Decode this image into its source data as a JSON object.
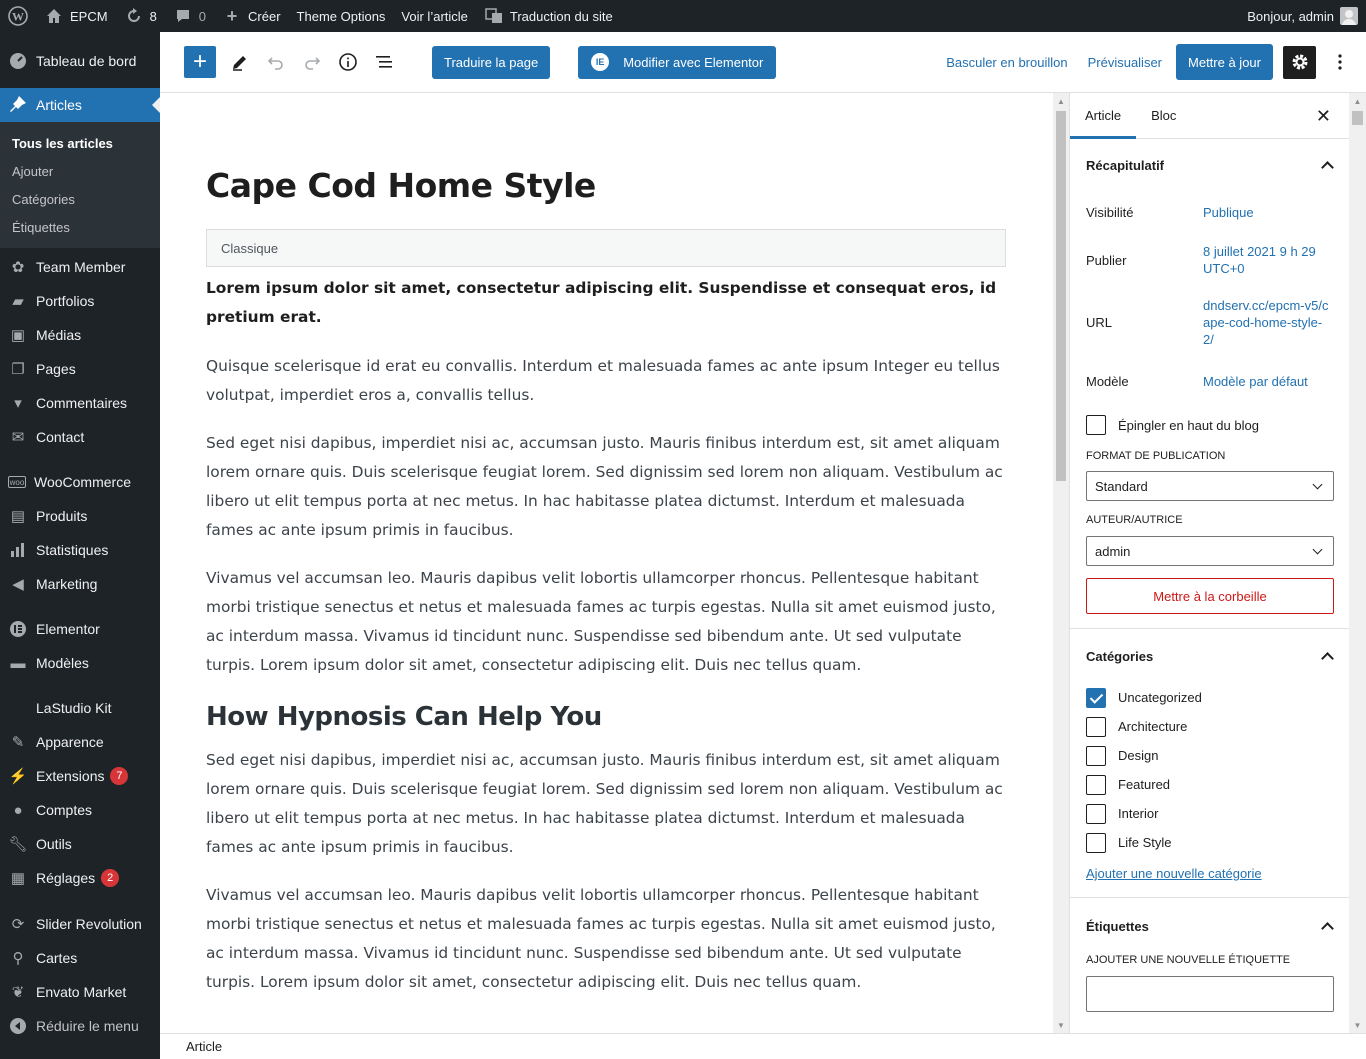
{
  "adminbar": {
    "site_name": "EPCM",
    "updates_count": "8",
    "comments_count": "0",
    "create_label": "Créer",
    "theme_options": "Theme Options",
    "view_post": "Voir l’article",
    "translate_site": "Traduction du site",
    "greeting": "Bonjour, admin"
  },
  "sidebar": {
    "dashboard": "Tableau de bord",
    "articles": "Articles",
    "sub": [
      "Tous les articles",
      "Ajouter",
      "Catégories",
      "Étiquettes"
    ],
    "items_a": [
      "Team Member",
      "Portfolios",
      "Médias",
      "Pages",
      "Commentaires",
      "Contact"
    ],
    "items_b": [
      "WooCommerce",
      "Produits",
      "Statistiques",
      "Marketing"
    ],
    "items_c": [
      "Elementor",
      "Modèles"
    ],
    "items_d": [
      "LaStudio Kit",
      "Apparence",
      "Extensions",
      "Comptes",
      "Outils",
      "Réglages"
    ],
    "extensions_badge": "7",
    "reglages_badge": "2",
    "items_e": [
      "Slider Revolution",
      "Cartes",
      "Envato Market"
    ],
    "collapse": "Réduire le menu"
  },
  "header": {
    "translate_page": "Traduire la page",
    "elementor": "Modifier avec Elementor",
    "draft": "Basculer en brouillon",
    "preview": "Prévisualiser",
    "update": "Mettre à jour"
  },
  "post": {
    "title": "Cape Cod Home Style",
    "classic_label": "Classique",
    "lead": "Lorem ipsum dolor sit amet, consectetur adipiscing elit. Suspendisse et consequat eros, id pretium erat.",
    "p1": "Quisque scelerisque id erat eu convallis. Interdum et malesuada fames ac ante ipsum Integer eu tellus volutpat, imperdiet eros a, convallis tellus.",
    "p2": "Sed eget nisi dapibus, imperdiet nisi ac, accumsan justo. Mauris finibus interdum est, sit amet aliquam lorem ornare quis. Duis scelerisque feugiat lorem. Sed dignissim sed lorem non aliquam. Vestibulum ac libero ut elit tempus porta at nec metus. In hac habitasse platea dictumst. Interdum et malesuada fames ac ante ipsum primis in faucibus.",
    "p3": "Vivamus vel accumsan leo. Mauris dapibus velit lobortis ullamcorper rhoncus. Pellentesque habitant morbi tristique senectus et netus et malesuada fames ac turpis egestas. Nulla sit amet euismod justo, ac interdum massa. Vivamus id tincidunt nunc. Suspendisse sed bibendum ante. Ut sed vulputate turpis. Lorem ipsum dolor sit amet, consectetur adipiscing elit. Duis nec tellus quam.",
    "h2": "How Hypnosis Can Help You",
    "p4": "Sed eget nisi dapibus, imperdiet nisi ac, accumsan justo. Mauris finibus interdum est, sit amet aliquam lorem ornare quis. Duis scelerisque feugiat lorem. Sed dignissim sed lorem non aliquam. Vestibulum ac libero ut elit tempus porta at nec metus. In hac habitasse platea dictumst. Interdum et malesuada fames ac ante ipsum primis in faucibus.",
    "p5": "Vivamus vel accumsan leo. Mauris dapibus velit lobortis ullamcorper rhoncus. Pellentesque habitant morbi tristique senectus et netus et malesuada fames ac turpis egestas. Nulla sit amet euismod justo, ac interdum massa. Vivamus id tincidunt nunc. Suspendisse sed bibendum ante. Ut sed vulputate turpis. Lorem ipsum dolor sit amet, consectetur adipiscing elit. Duis nec tellus quam."
  },
  "settings": {
    "tab_article": "Article",
    "tab_bloc": "Bloc",
    "summary_title": "Récapitulatif",
    "visibility_label": "Visibilité",
    "visibility_value": "Publique",
    "publish_label": "Publier",
    "publish_value": "8 juillet 2021 9 h 29 UTC+0",
    "url_label": "URL",
    "url_value": "dndserv.cc/epcm-v5/cape-cod-home-style-2/",
    "template_label": "Modèle",
    "template_value": "Modèle par défaut",
    "sticky_label": "Épingler en haut du blog",
    "format_label": "FORMAT DE PUBLICATION",
    "format_value": "Standard",
    "author_label": "AUTEUR/AUTRICE",
    "author_value": "admin",
    "trash": "Mettre à la corbeille",
    "categories_title": "Catégories",
    "categories": [
      {
        "name": "Uncategorized",
        "checked": true
      },
      {
        "name": "Architecture",
        "checked": false
      },
      {
        "name": "Design",
        "checked": false
      },
      {
        "name": "Featured",
        "checked": false
      },
      {
        "name": "Interior",
        "checked": false
      },
      {
        "name": "Life Style",
        "checked": false
      }
    ],
    "add_category": "Ajouter une nouvelle catégorie",
    "tags_title": "Étiquettes",
    "add_tag_label": "AJOUTER UNE NOUVELLE ÉTIQUETTE"
  },
  "footer": {
    "breadcrumb": "Article"
  },
  "colors": {
    "accent": "#2271b1",
    "admin_dark": "#1d2327",
    "danger": "#cc1818",
    "badge": "#d63638"
  }
}
